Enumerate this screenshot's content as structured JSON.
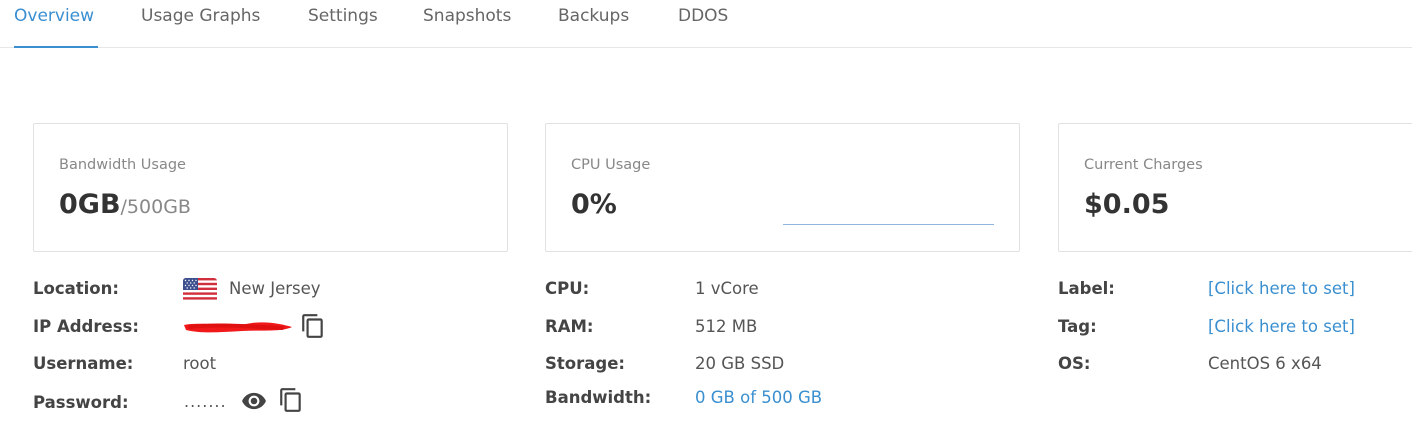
{
  "tabs": [
    {
      "label": "Overview",
      "active": true
    },
    {
      "label": "Usage Graphs",
      "active": false
    },
    {
      "label": "Settings",
      "active": false
    },
    {
      "label": "Snapshots",
      "active": false
    },
    {
      "label": "Backups",
      "active": false
    },
    {
      "label": "DDOS",
      "active": false
    }
  ],
  "cards": {
    "bandwidth": {
      "title": "Bandwidth Usage",
      "value": "0GB",
      "sub": "/500GB"
    },
    "cpu": {
      "title": "CPU Usage",
      "value": "0%"
    },
    "charges": {
      "title": "Current Charges",
      "value": "$0.05"
    }
  },
  "details": {
    "location_label": "Location:",
    "location_value": "New Jersey",
    "ip_label": "IP Address:",
    "username_label": "Username:",
    "username_value": "root",
    "password_label": "Password:",
    "password_value": ".......",
    "cpu_label": "CPU:",
    "cpu_value": "1 vCore",
    "ram_label": "RAM:",
    "ram_value": "512 MB",
    "storage_label": "Storage:",
    "storage_value": "20 GB SSD",
    "bandwidth_label": "Bandwidth:",
    "bandwidth_value": "0 GB of 500 GB",
    "label_label": "Label:",
    "label_value": "[Click here to set]",
    "tag_label": "Tag:",
    "tag_value": "[Click here to set]",
    "os_label": "OS:",
    "os_value": "CentOS 6 x64"
  },
  "icons": {
    "flag": "us-flag-icon",
    "copy": "copy-icon",
    "eye": "eye-icon"
  },
  "colors": {
    "accent": "#3a8fd0",
    "redaction": "#f01818"
  }
}
